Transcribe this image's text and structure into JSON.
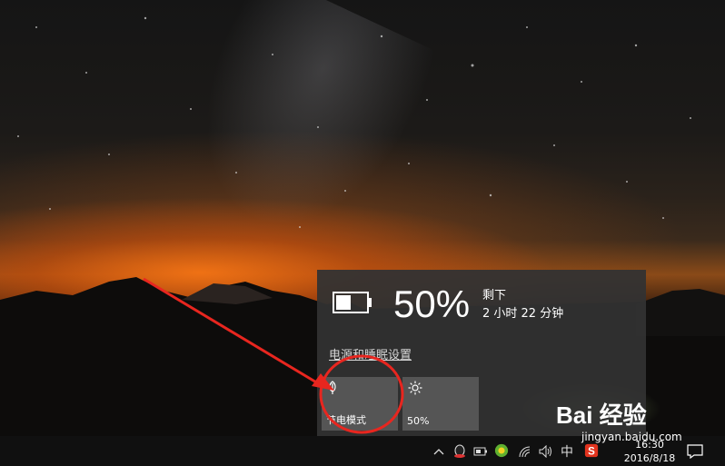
{
  "battery": {
    "percent": "50%",
    "remaining_label": "剩下",
    "remaining_time": "2 小时 22 分钟",
    "settings_link": "电源和睡眠设置",
    "level": 0.5
  },
  "tiles": {
    "battery_saver": {
      "label": "节电模式",
      "icon": "leaf-icon",
      "active": false
    },
    "brightness": {
      "label": "50%",
      "icon": "sun-icon"
    }
  },
  "taskbar": {
    "input_method": "中",
    "time": "16:30",
    "date": "2016/8/18"
  },
  "annotation": {
    "color": "#e8261f"
  },
  "watermark": {
    "logo": "Bai 经验",
    "url": "jingyan.baidu.com"
  }
}
